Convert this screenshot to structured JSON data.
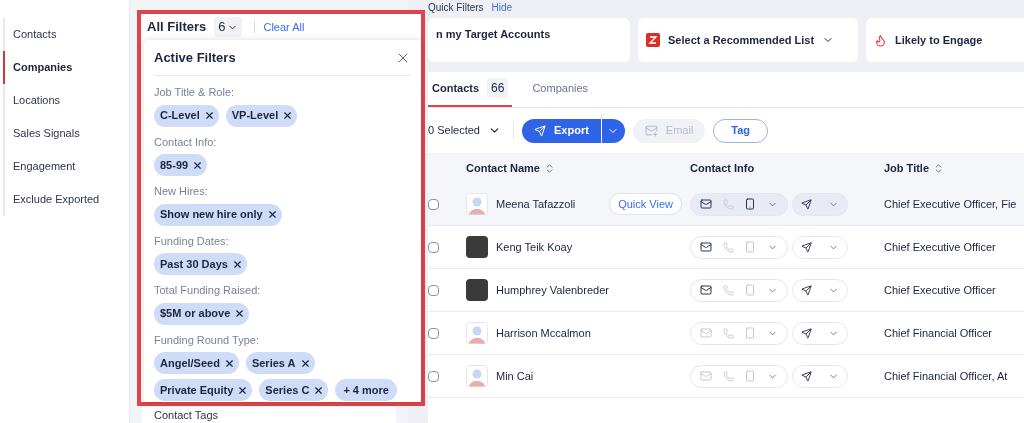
{
  "sidebar": {
    "items": [
      {
        "label": "Contacts",
        "selected": false
      },
      {
        "label": "Companies",
        "selected": true
      },
      {
        "label": "Locations",
        "selected": false
      },
      {
        "label": "Sales Signals",
        "selected": false
      },
      {
        "label": "Engagement",
        "selected": false
      },
      {
        "label": "Exclude Exported",
        "selected": false
      }
    ]
  },
  "filters_panel": {
    "title": "All Filters",
    "count": "6",
    "clear": "Clear All",
    "behind_label": "Contact Tags",
    "active_filters": {
      "title": "Active Filters",
      "groups": [
        {
          "label": "Job Title & Role:",
          "chips": [
            {
              "kind": "filter",
              "text": "C-Level"
            },
            {
              "kind": "filter",
              "text": "VP-Level"
            }
          ]
        },
        {
          "label": "Contact Info:",
          "chips": [
            {
              "kind": "filter",
              "text": "85-99"
            }
          ]
        },
        {
          "label": "New Hires:",
          "chips": [
            {
              "kind": "filter",
              "text": "Show new hire only"
            }
          ]
        },
        {
          "label": "Funding Dates:",
          "chips": [
            {
              "kind": "filter",
              "text": "Past 30 Days"
            }
          ]
        },
        {
          "label": "Total Funding Raised:",
          "chips": [
            {
              "kind": "filter",
              "text": "$5M or above"
            }
          ]
        },
        {
          "label": "Funding Round Type:",
          "chips": [
            {
              "kind": "filter",
              "text": "Angel/Seed"
            },
            {
              "kind": "filter",
              "text": "Series A"
            },
            {
              "kind": "filter",
              "text": "Private Equity"
            },
            {
              "kind": "filter",
              "text": "Series C"
            },
            {
              "kind": "more",
              "text": "+ 4 more"
            }
          ]
        }
      ]
    }
  },
  "quick_filters": {
    "title": "Quick Filters",
    "hide": "Hide",
    "cards": [
      {
        "kind": "plain",
        "label": "n my Target Accounts"
      },
      {
        "kind": "list",
        "label": "Select a Recommended List"
      },
      {
        "kind": "fire",
        "label": "Likely to Engage"
      }
    ]
  },
  "tabs": [
    {
      "label": "Contacts",
      "count": "66",
      "selected": true
    },
    {
      "label": "Companies",
      "selected": false
    }
  ],
  "toolbar": {
    "selected": "0 Selected",
    "export": "Export",
    "email": {
      "label": "Email",
      "disabled": true
    },
    "tag": "Tag"
  },
  "table": {
    "columns": [
      {
        "label": "Contact Name",
        "sortable": true
      },
      {
        "label": "Contact Info",
        "sortable": false
      },
      {
        "label": "Job Title",
        "sortable": true
      }
    ],
    "rows": [
      {
        "name": "Meena Tafazzoli",
        "kind": "placeholder",
        "highlighted": true,
        "quick_view": "Quick View",
        "email": true,
        "mobile": true,
        "job": "Chief Executive Officer, Fie"
      },
      {
        "name": "Keng Teik Koay",
        "kind": "photo",
        "highlighted": false,
        "email": true,
        "mobile": false,
        "job": "Chief Executive Officer"
      },
      {
        "name": "Humphrey Valenbreder",
        "kind": "photo",
        "highlighted": false,
        "email": true,
        "mobile": false,
        "job": "Chief Executive Officer"
      },
      {
        "name": "Harrison Mccalmon",
        "kind": "placeholder",
        "highlighted": false,
        "email": false,
        "mobile": false,
        "job": "Chief Financial Officer"
      },
      {
        "name": "Min Cai",
        "kind": "placeholder",
        "highlighted": false,
        "email": false,
        "mobile": false,
        "job": "Chief Financial Officer, At"
      }
    ]
  }
}
